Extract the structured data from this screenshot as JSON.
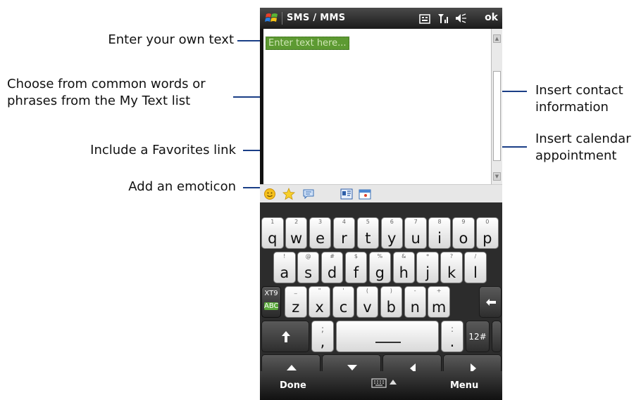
{
  "callouts": {
    "own_text": "Enter your own text",
    "my_text_line1": "Choose from common words or",
    "my_text_line2": "phrases from the My Text list",
    "favorites": "Include a Favorites link",
    "emoticon": "Add an emoticon",
    "contact_line1": "Insert contact",
    "contact_line2": "information",
    "calendar_line1": "Insert calendar",
    "calendar_line2": "appointment"
  },
  "titlebar": {
    "title": "SMS / MMS",
    "ok": "ok"
  },
  "compose": {
    "placeholder": "Enter text here..."
  },
  "toolbar_icons": [
    "emoticon-icon",
    "favorites-star-icon",
    "my-text-icon",
    "contact-card-icon",
    "calendar-icon"
  ],
  "keyboard": {
    "row1": [
      {
        "main": "q",
        "sub": "1"
      },
      {
        "main": "w",
        "sub": "2"
      },
      {
        "main": "e",
        "sub": "3"
      },
      {
        "main": "r",
        "sub": "4"
      },
      {
        "main": "t",
        "sub": "5"
      },
      {
        "main": "y",
        "sub": "6"
      },
      {
        "main": "u",
        "sub": "7"
      },
      {
        "main": "i",
        "sub": "8"
      },
      {
        "main": "o",
        "sub": "9"
      },
      {
        "main": "p",
        "sub": "0"
      }
    ],
    "row2": [
      {
        "main": "a",
        "sub": "!"
      },
      {
        "main": "s",
        "sub": "@"
      },
      {
        "main": "d",
        "sub": "#"
      },
      {
        "main": "f",
        "sub": "$"
      },
      {
        "main": "g",
        "sub": "%"
      },
      {
        "main": "h",
        "sub": "&"
      },
      {
        "main": "j",
        "sub": "*"
      },
      {
        "main": "k",
        "sub": "?"
      },
      {
        "main": "l",
        "sub": "/"
      }
    ],
    "row3": [
      {
        "main": "z",
        "sub": "_"
      },
      {
        "main": "x",
        "sub": "\""
      },
      {
        "main": "c",
        "sub": "'"
      },
      {
        "main": "v",
        "sub": "("
      },
      {
        "main": "b",
        "sub": ")"
      },
      {
        "main": "n",
        "sub": "-"
      },
      {
        "main": "m",
        "sub": "+"
      }
    ],
    "xt9_label": "XT9",
    "abc_label": "ABC",
    "semicolon_sub": ";",
    "comma_main": ",",
    "colon_sub": ":",
    "period_main": ".",
    "num_key": "12#"
  },
  "bottombar": {
    "left": "Done",
    "right": "Menu"
  },
  "colors": {
    "callout_line": "#1a3e86",
    "placeholder_bg": "#5d9a32"
  }
}
